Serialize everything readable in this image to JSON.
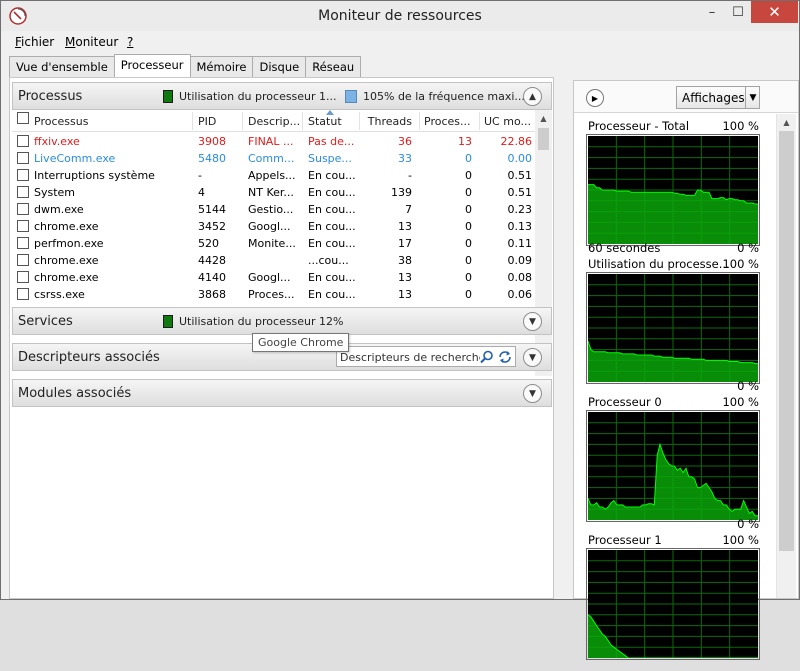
{
  "window": {
    "title": "Moniteur de ressources",
    "buttons": {
      "minimize": "–",
      "maximize": "☐",
      "close": "✕"
    }
  },
  "menu": {
    "items": [
      {
        "underline": "F",
        "rest": "ichier"
      },
      {
        "underline": "M",
        "rest": "oniteur"
      },
      {
        "underline": "?",
        "rest": ""
      }
    ]
  },
  "tabs": [
    {
      "label": "Vue d'ensemble",
      "active": false
    },
    {
      "label": "Processeur",
      "active": true
    },
    {
      "label": "Mémoire",
      "active": false
    },
    {
      "label": "Disque",
      "active": false
    },
    {
      "label": "Réseau",
      "active": false
    }
  ],
  "processus": {
    "title": "Processus",
    "legend_util": "Utilisation du processeur 1...",
    "legend_freq": "105% de la fréquence maxi...",
    "columns": [
      "Processus",
      "PID",
      "Descrip...",
      "Statut",
      "Threads",
      "Proces...",
      "UC mo..."
    ],
    "rows": [
      {
        "name": "ffxiv.exe",
        "pid": "3908",
        "desc": "FINAL ...",
        "status": "Pas de...",
        "threads": "36",
        "proc": "13",
        "cpu": "22.86",
        "color": "red"
      },
      {
        "name": "LiveComm.exe",
        "pid": "5480",
        "desc": "Comm...",
        "status": "Suspe...",
        "threads": "33",
        "proc": "0",
        "cpu": "0.00",
        "color": "blue"
      },
      {
        "name": "Interruptions système",
        "pid": "-",
        "desc": "Appels...",
        "status": "En cou...",
        "threads": "-",
        "proc": "0",
        "cpu": "0.51",
        "color": ""
      },
      {
        "name": "System",
        "pid": "4",
        "desc": "NT Ker...",
        "status": "En cou...",
        "threads": "139",
        "proc": "0",
        "cpu": "0.51",
        "color": ""
      },
      {
        "name": "dwm.exe",
        "pid": "5144",
        "desc": "Gestio...",
        "status": "En cou...",
        "threads": "7",
        "proc": "0",
        "cpu": "0.23",
        "color": ""
      },
      {
        "name": "chrome.exe",
        "pid": "3452",
        "desc": "Googl...",
        "status": "En cou...",
        "threads": "13",
        "proc": "0",
        "cpu": "0.13",
        "color": ""
      },
      {
        "name": "perfmon.exe",
        "pid": "520",
        "desc": "Monite...",
        "status": "En cou...",
        "threads": "17",
        "proc": "0",
        "cpu": "0.11",
        "color": ""
      },
      {
        "name": "chrome.exe",
        "pid": "4428",
        "desc": "",
        "status": "...cou...",
        "threads": "38",
        "proc": "0",
        "cpu": "0.09",
        "color": ""
      },
      {
        "name": "chrome.exe",
        "pid": "4140",
        "desc": "Googl...",
        "status": "En cou...",
        "threads": "13",
        "proc": "0",
        "cpu": "0.08",
        "color": ""
      },
      {
        "name": "csrss.exe",
        "pid": "3868",
        "desc": "Proces...",
        "status": "En cou...",
        "threads": "13",
        "proc": "0",
        "cpu": "0.06",
        "color": ""
      }
    ],
    "tooltip": "Google Chrome"
  },
  "services": {
    "title": "Services",
    "legend_util": "Utilisation du processeur 12%"
  },
  "descripteurs": {
    "title": "Descripteurs associés",
    "search_placeholder": "Descripteurs de recherche"
  },
  "modules": {
    "title": "Modules associés"
  },
  "right": {
    "views_label": "Affichages",
    "graphs": [
      {
        "title": "Processeur - Total",
        "top_pct": "100 %",
        "bottom_left": "60 secondes",
        "bottom_pct": "0 %",
        "values": [
          55,
          55,
          55,
          52,
          52,
          50,
          50,
          50,
          50,
          50,
          49,
          49,
          49,
          49,
          49,
          48,
          48,
          48,
          48,
          48,
          48,
          48,
          48,
          48,
          48,
          48,
          48,
          48,
          48,
          48,
          47,
          47,
          46,
          46,
          45,
          45,
          45,
          45,
          50,
          50,
          48,
          48,
          48,
          42,
          42,
          42,
          43,
          43,
          41,
          42,
          42,
          41,
          41,
          40,
          40,
          38,
          38,
          38,
          37,
          37
        ]
      },
      {
        "title": "Utilisation du processe...",
        "top_pct": "100 %",
        "bottom_left": "",
        "bottom_pct": "0 %",
        "values": [
          38,
          30,
          28,
          28,
          28,
          28,
          28,
          27,
          27,
          27,
          27,
          27,
          26,
          26,
          26,
          26,
          26,
          25,
          25,
          25,
          25,
          25,
          25,
          24,
          24,
          24,
          23,
          23,
          23,
          23,
          22,
          22,
          22,
          22,
          22,
          22,
          21,
          21,
          21,
          21,
          21,
          20,
          20,
          20,
          20,
          20,
          20,
          20,
          20,
          19,
          19,
          19,
          19,
          18,
          18,
          18,
          18,
          18,
          17,
          17
        ]
      },
      {
        "title": "Processeur 0",
        "top_pct": "100 %",
        "bottom_left": "",
        "bottom_pct": "0 %",
        "values": [
          20,
          14,
          14,
          16,
          12,
          12,
          10,
          12,
          16,
          18,
          14,
          14,
          14,
          12,
          12,
          12,
          12,
          12,
          12,
          14,
          14,
          15,
          15,
          14,
          60,
          70,
          62,
          56,
          52,
          50,
          50,
          46,
          48,
          44,
          48,
          40,
          40,
          38,
          30,
          30,
          32,
          34,
          30,
          26,
          20,
          18,
          18,
          14,
          14,
          10,
          8,
          10,
          10,
          10,
          18,
          12,
          6,
          8,
          4,
          4
        ]
      },
      {
        "title": "Processeur 1",
        "top_pct": "100 %",
        "bottom_left": "",
        "bottom_pct": "",
        "values": [
          40,
          38,
          34,
          30,
          26,
          22,
          20,
          16,
          12,
          10,
          8,
          6,
          4,
          2,
          0,
          0,
          0,
          0,
          0,
          0,
          0,
          0,
          0,
          0,
          0,
          0,
          0,
          0,
          0,
          0,
          0,
          0,
          0,
          0,
          0,
          0,
          0,
          0,
          0,
          0,
          0,
          0,
          0,
          0,
          0,
          0,
          0,
          0,
          0,
          0,
          0,
          0,
          0,
          0,
          0,
          0,
          0,
          0,
          0,
          0
        ]
      }
    ]
  },
  "colors": {
    "close": "#c7463e",
    "graph_bg": "#000000",
    "graph_line": "#00ff00",
    "graph_fill": "#0aa60a",
    "grid": "#0b6b0b"
  }
}
